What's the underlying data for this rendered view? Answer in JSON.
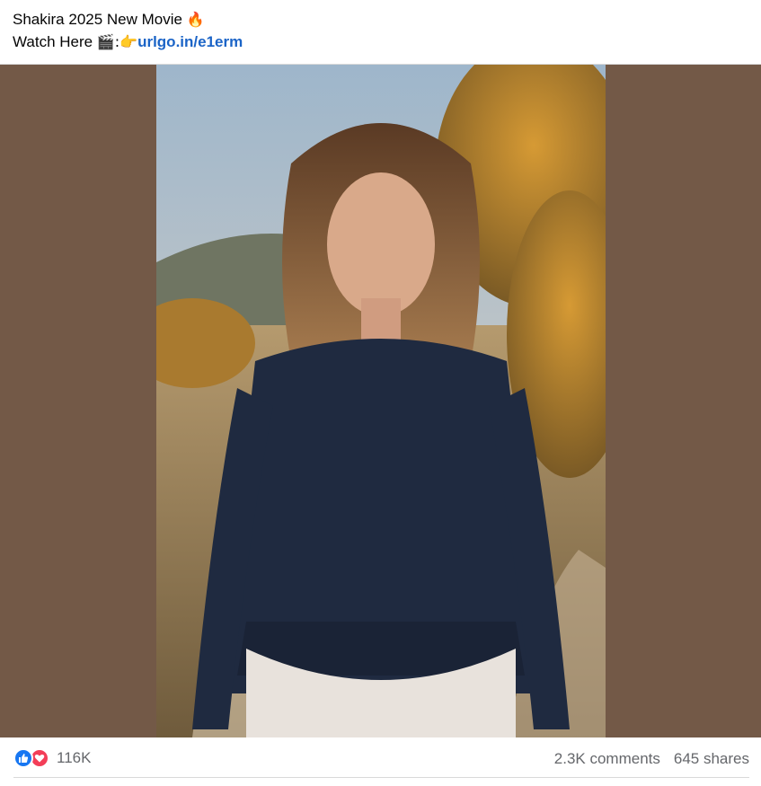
{
  "post": {
    "line1_text": "Shakira 2025 New Movie ",
    "line1_emoji": "🔥",
    "line2_prefix": "Watch Here ",
    "line2_emoji": "🎬:👉",
    "link_text": "urlgo.in/e1erm"
  },
  "media": {
    "background_color": "#735947",
    "icon": "photo-image"
  },
  "footer": {
    "reaction_icons": [
      "like-icon",
      "love-icon"
    ],
    "reaction_count": "116K",
    "comments": "2.3K comments",
    "shares": "645 shares"
  },
  "colors": {
    "link": "#1b64c7",
    "like": "#1877f2",
    "love": "#f33e58",
    "muted": "#65676b"
  }
}
